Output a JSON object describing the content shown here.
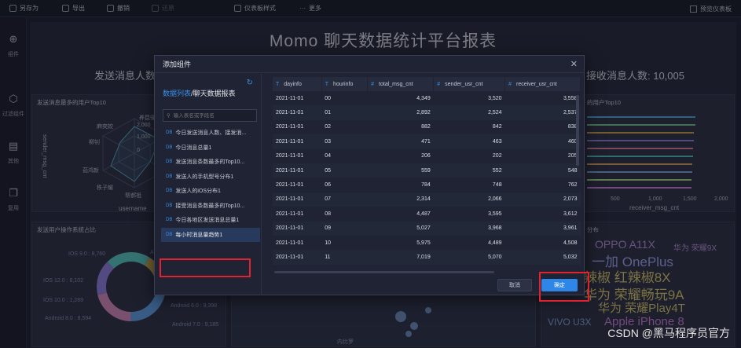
{
  "toolbar": {
    "items": [
      {
        "label": "另存为",
        "icon": "save-as-icon"
      },
      {
        "label": "导出",
        "icon": "export-icon"
      },
      {
        "label": "撤销",
        "icon": "undo-icon"
      },
      {
        "label": "还原",
        "icon": "redo-icon"
      },
      {
        "label": "仪表板样式",
        "icon": "style-icon"
      },
      {
        "label": "更多",
        "icon": "more-icon"
      }
    ],
    "preview": "预览仪表板"
  },
  "rail": [
    {
      "label": "组件",
      "icon": "plus-circle-icon"
    },
    {
      "label": "过滤组件",
      "icon": "cube-icon"
    },
    {
      "label": "其他",
      "icon": "document-icon"
    },
    {
      "label": "复用",
      "icon": "copy-icon"
    }
  ],
  "dashboard": {
    "title": "Momo 聊天数据统计平台报表",
    "stat_left": "发送消息人数:",
    "stat_right": "接收消息人数: 10,005",
    "panel1_title": "发送消息最多的用户Top10",
    "panel2_title": "的用户Top10",
    "panel3_title": "发送用户操作系统占比",
    "panel4_title": "分布",
    "radar": {
      "labels": [
        "养昆驿",
        "麻奕姣",
        "柳钊",
        "茹鸿新",
        "秩子耀",
        "帮郝祖"
      ],
      "ticks": [
        "2,000",
        "1,000",
        "0"
      ],
      "ylabel": "sender_msg_cnt",
      "xlabel": "username"
    },
    "bar_axis": {
      "ticks": [
        "500",
        "1,000",
        "1,500",
        "2,000"
      ],
      "xlabel": "receiver_msg_cnt"
    },
    "donut_labels": [
      "IOS 9.0 : 8,760",
      "IOS 12.0 : 8,102",
      "IOS 10.0 : 1,289",
      "Android 8.0 : 8,594",
      "Android 7.0 : 9,185",
      "Android 6.0 : 9,398",
      "A"
    ],
    "map_label": "内比罗",
    "wordcloud": [
      "OPPO A11X",
      "华为 荣耀9X",
      "一加 OnePlus",
      "辣椒 红辣椒8X",
      "华为 荣耀畅玩9A",
      "华为 荣耀Play4T",
      "VIVO U3X",
      "Apple iPhone 8"
    ],
    "watermark": "CSDN @黑马程序员官方"
  },
  "modal": {
    "title": "添加组件",
    "datasource_prefix": "数据列表",
    "datasource_name": "/聊天数据报表",
    "search_placeholder": "输入表名或字段名",
    "tables": [
      "今日发送消息人数、接发消...",
      "今日消息总量1",
      "发送消息条数最多的Top10...",
      "发送人的手机型号分布1",
      "发送人的iOS分布1",
      "接受消息条数最多的Top10...",
      "今日各地区发送消息总量1",
      "每小时消息量趋势1"
    ],
    "db_tag": "DB",
    "columns": [
      {
        "name": "dayinfo",
        "type": "T"
      },
      {
        "name": "hourinfo",
        "type": "T"
      },
      {
        "name": "total_msg_cnt",
        "type": "#"
      },
      {
        "name": "sender_usr_cnt",
        "type": "#"
      },
      {
        "name": "receiver_usr_cnt",
        "type": "#"
      }
    ],
    "rows": [
      [
        "2021-11-01",
        "00",
        "4,349",
        "3,520",
        "3,558"
      ],
      [
        "2021-11-01",
        "01",
        "2,892",
        "2,524",
        "2,537"
      ],
      [
        "2021-11-01",
        "02",
        "882",
        "842",
        "838"
      ],
      [
        "2021-11-01",
        "03",
        "471",
        "463",
        "460"
      ],
      [
        "2021-11-01",
        "04",
        "206",
        "202",
        "205"
      ],
      [
        "2021-11-01",
        "05",
        "559",
        "552",
        "548"
      ],
      [
        "2021-11-01",
        "06",
        "784",
        "748",
        "762"
      ],
      [
        "2021-11-01",
        "07",
        "2,314",
        "2,066",
        "2,073"
      ],
      [
        "2021-11-01",
        "08",
        "4,487",
        "3,595",
        "3,612"
      ],
      [
        "2021-11-01",
        "09",
        "5,027",
        "3,968",
        "3,961"
      ],
      [
        "2021-11-01",
        "10",
        "5,975",
        "4,489",
        "4,508"
      ],
      [
        "2021-11-01",
        "11",
        "7,019",
        "5,070",
        "5,032"
      ]
    ],
    "cancel": "取消",
    "confirm": "确定"
  }
}
